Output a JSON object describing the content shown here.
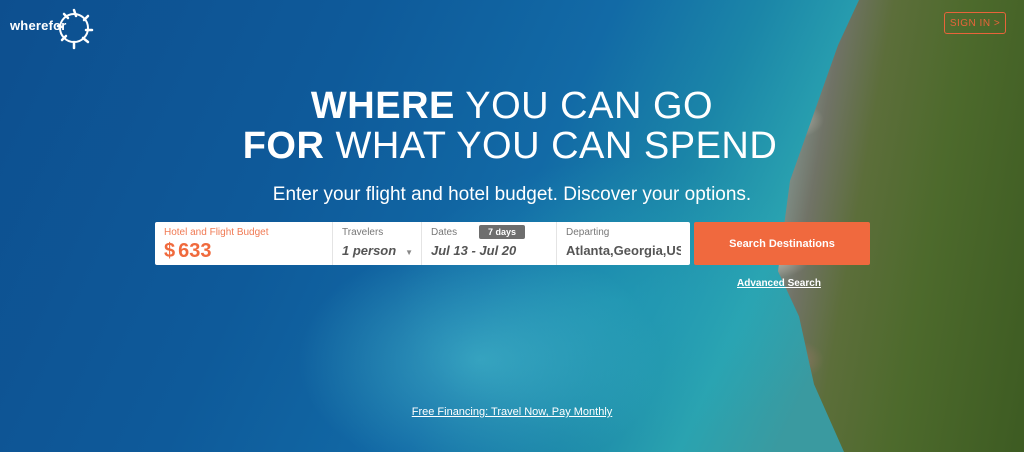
{
  "header": {
    "logo_text": "wherefor",
    "signin_label": "SIGN IN >"
  },
  "hero": {
    "headline_line1_bold": "WHERE",
    "headline_line1_rest": "YOU CAN GO",
    "headline_line2_bold": "FOR",
    "headline_line2_rest": "WHAT YOU CAN SPEND",
    "subheading": "Enter your flight and hotel budget. Discover your options."
  },
  "search": {
    "budget_label": "Hotel and Flight Budget",
    "budget_currency": "$",
    "budget_value": "633",
    "travelers_label": "Travelers",
    "travelers_value": "1 person",
    "dates_label": "Dates",
    "dates_badge": "7 days",
    "dates_value": "Jul 13 - Jul 20",
    "departing_label": "Departing",
    "departing_value": "Atlanta,Georgia,US",
    "button_label": "Search Destinations",
    "advanced_link": "Advanced Search"
  },
  "footer": {
    "financing_link": "Free Financing: Travel Now, Pay Monthly"
  },
  "colors": {
    "accent": "#f0693e",
    "signin_border": "#e8643a",
    "badge_bg": "#6d6d6d"
  },
  "icons": {
    "logo_mark": "globe-icon",
    "travelers_dropdown": "chevron-down-icon"
  }
}
